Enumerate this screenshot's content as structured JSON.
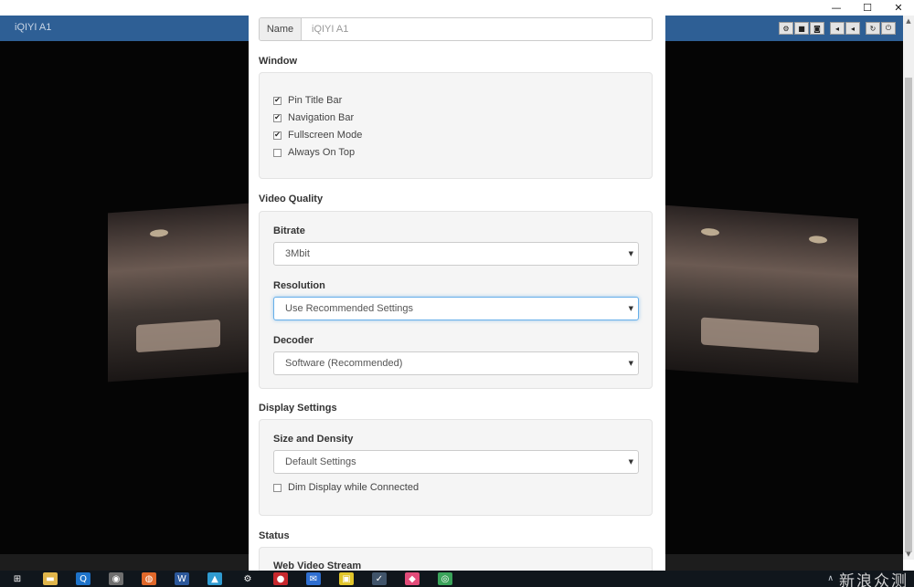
{
  "window": {
    "controls": [
      {
        "name": "minimize-icon",
        "glyph": "—"
      },
      {
        "name": "maximize-icon",
        "glyph": "☐"
      },
      {
        "name": "close-icon",
        "glyph": "✕"
      }
    ]
  },
  "app": {
    "title": "iQIYI A1",
    "toolbar": [
      [
        {
          "name": "settings-icon",
          "glyph": "⚙"
        },
        {
          "name": "video-camera-icon",
          "glyph": "■"
        },
        {
          "name": "screenshot-camera-icon",
          "glyph": "◙"
        }
      ],
      [
        {
          "name": "volume-down-icon",
          "glyph": "◂"
        },
        {
          "name": "volume-up-icon",
          "glyph": "◂"
        }
      ],
      [
        {
          "name": "rotate-icon",
          "glyph": "↻"
        },
        {
          "name": "power-icon",
          "glyph": "⏻"
        }
      ]
    ]
  },
  "settings": {
    "name_label": "Name",
    "name_value": "iQIYI A1",
    "window_section": "Window",
    "window_options": [
      {
        "label": "Pin Title Bar",
        "checked": true
      },
      {
        "label": "Navigation Bar",
        "checked": true
      },
      {
        "label": "Fullscreen Mode",
        "checked": true
      },
      {
        "label": "Always On Top",
        "checked": false
      }
    ],
    "video_quality_section": "Video Quality",
    "bitrate_label": "Bitrate",
    "bitrate_value": "3Mbit",
    "resolution_label": "Resolution",
    "resolution_value": "Use Recommended Settings",
    "decoder_label": "Decoder",
    "decoder_value": "Software (Recommended)",
    "display_section": "Display Settings",
    "size_density_label": "Size and Density",
    "size_density_value": "Default Settings",
    "dim_display_label": "Dim Display while Connected",
    "dim_display_checked": false,
    "status_section": "Status",
    "web_video_stream_label": "Web Video Stream"
  },
  "taskbar": {
    "icons": [
      {
        "name": "windows-start-icon",
        "glyph": "⊞",
        "bg": "transparent"
      },
      {
        "name": "file-explorer-icon",
        "glyph": "▬",
        "bg": "#e0b54a"
      },
      {
        "name": "browser-q-icon",
        "glyph": "Q",
        "bg": "#1e73c9"
      },
      {
        "name": "app-generic-icon",
        "glyph": "◉",
        "bg": "#6f6f6f"
      },
      {
        "name": "firefox-icon",
        "glyph": "◍",
        "bg": "#e0682a"
      },
      {
        "name": "word-icon",
        "glyph": "W",
        "bg": "#2b579a"
      },
      {
        "name": "image-app-icon",
        "glyph": "▲",
        "bg": "#2f9bd1"
      },
      {
        "name": "settings-gear-icon",
        "glyph": "⚙",
        "bg": "transparent"
      },
      {
        "name": "red-app-icon",
        "glyph": "●",
        "bg": "#c8282d"
      },
      {
        "name": "mail-shield-icon",
        "glyph": "✉",
        "bg": "#2f6fd1"
      },
      {
        "name": "notes-app-icon",
        "glyph": "▣",
        "bg": "#e1c52a"
      },
      {
        "name": "active-app-icon",
        "glyph": "✓",
        "bg": "#40546a"
      },
      {
        "name": "pink-app-icon",
        "glyph": "◆",
        "bg": "#e24b79"
      },
      {
        "name": "chrome-icon",
        "glyph": "◎",
        "bg": "#3aa35a"
      }
    ],
    "watermark": "新浪众测"
  }
}
